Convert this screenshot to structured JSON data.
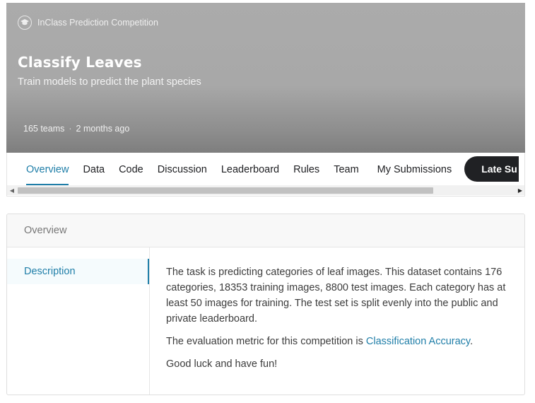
{
  "banner": {
    "competition_type": "InClass Prediction Competition",
    "title": "Classify Leaves",
    "subtitle": "Train models to predict the plant species",
    "teams": "165 teams",
    "separator": "·",
    "time_ago": "2 months ago",
    "icon": "graduation-cap-icon"
  },
  "tabs": [
    {
      "label": "Overview",
      "active": true
    },
    {
      "label": "Data"
    },
    {
      "label": "Code"
    },
    {
      "label": "Discussion"
    },
    {
      "label": "Leaderboard"
    },
    {
      "label": "Rules"
    },
    {
      "label": "Team"
    },
    {
      "label": "My Submissions"
    }
  ],
  "late_submission_label": "Late Su",
  "overview": {
    "header": "Overview",
    "side_item": "Description",
    "paragraph1": "The task is predicting categories of leaf images. This dataset contains 176 categories, 18353 training images, 8800 test images. Each category has at least 50 images for training. The test set is split evenly into the public and private leaderboard.",
    "metric_prefix": "The evaluation metric for this competition is ",
    "metric_link": "Classification Accuracy",
    "metric_suffix": ".",
    "paragraph3": "Good luck and have fun!"
  },
  "colors": {
    "accent": "#1f7ea8",
    "banner": "#a8a8a8",
    "late_button": "#202124"
  }
}
